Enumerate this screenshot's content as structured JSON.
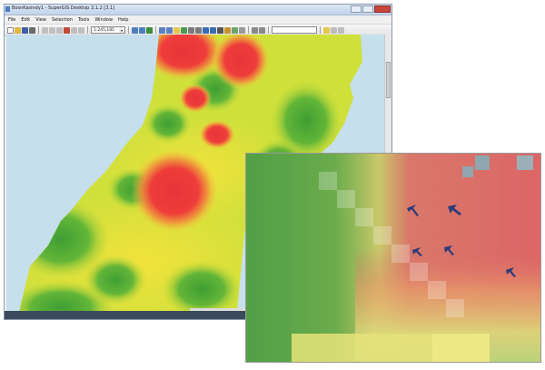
{
  "window": {
    "title": "BosnKasindy1 - SuperGIS Desktop 3.1.2 [3.1]",
    "menu": [
      "File",
      "Edit",
      "View",
      "Selection",
      "Tools",
      "Window",
      "Help"
    ]
  },
  "toolbar": {
    "scale_value": "1:245,185"
  },
  "colors": {
    "hot": "#e8333a",
    "warm": "#e8c830",
    "mid": "#d4e33a",
    "cool": "#46a634",
    "water": "#c6dfec",
    "status_bar": "#3b4a5c"
  },
  "icons": {
    "new": "new-file-icon",
    "open": "open-folder-icon",
    "save": "save-icon",
    "print": "print-icon",
    "zoom_in": "zoom-in-icon",
    "zoom_out": "zoom-out-icon",
    "pan": "pan-hand-icon",
    "identify": "identify-icon",
    "select": "select-arrow-icon",
    "wind_marker": "arrow-marker-icon"
  }
}
